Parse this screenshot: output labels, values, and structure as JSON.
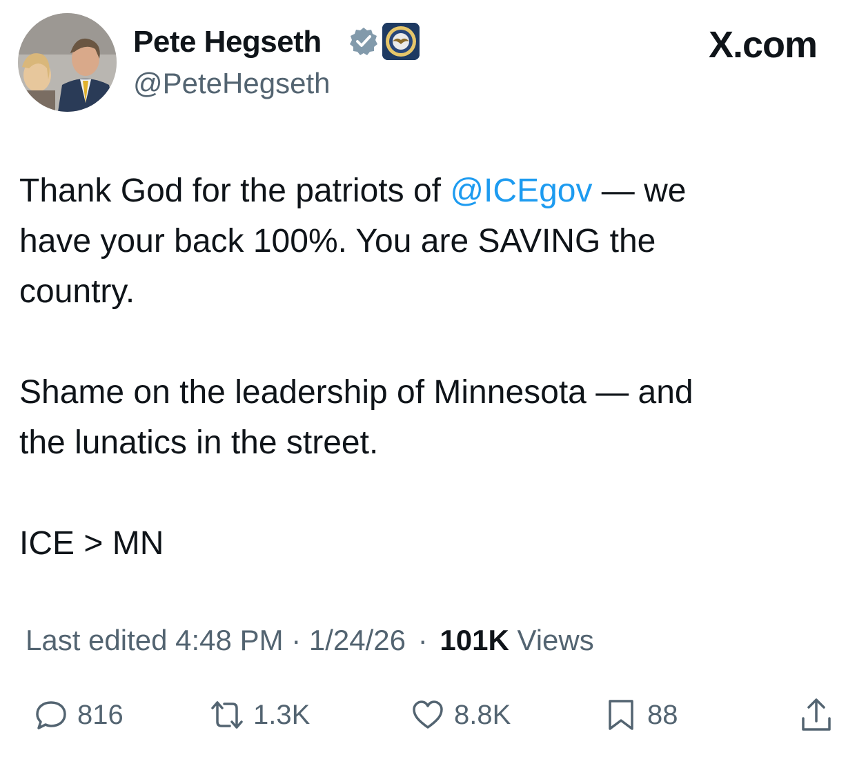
{
  "author": {
    "display_name": "Pete Hegseth",
    "handle": "@PeteHegseth",
    "verified_badge_icon": "verified-checkmark-icon",
    "affiliate_badge_icon": "department-seal-icon",
    "avatar_icon": "profile-photo"
  },
  "site": {
    "brand": "X.com"
  },
  "tweet": {
    "p1_before": "Thank God for the patriots of ",
    "p1_mention": "@ICEgov",
    "p1_line1_after": " — we",
    "p1_line2": "have your back 100%. You are SAVING the",
    "p1_line3": "country.",
    "p2_line1": "Shame on the leadership of Minnesota — and",
    "p2_line2": "the lunatics in the street.",
    "p3_line1": "ICE > MN"
  },
  "meta": {
    "edited_label": "Last edited 4:48 PM · 1/24/26",
    "separator": "·",
    "views_count": "101K",
    "views_label": "Views"
  },
  "actions": {
    "reply_count": "816",
    "repost_count": "1.3K",
    "like_count": "8.8K",
    "bookmark_count": "88"
  },
  "colors": {
    "text": "#0f1419",
    "secondary": "#536471",
    "link": "#1d9bf0",
    "verified": "#829aab"
  }
}
